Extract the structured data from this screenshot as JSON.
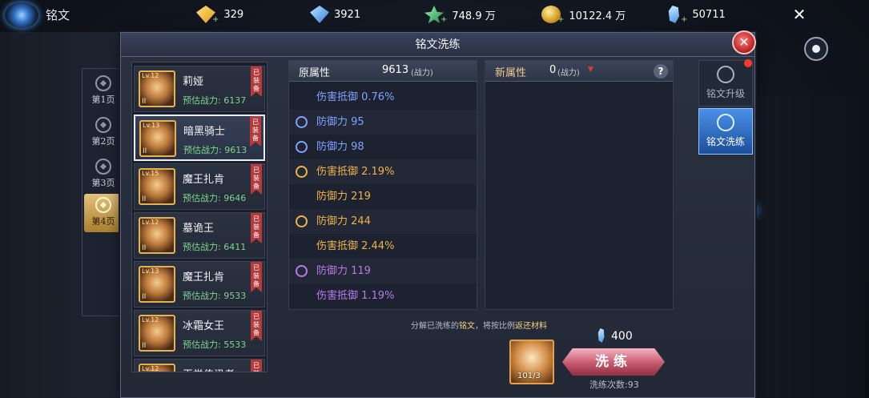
{
  "top_bar": {
    "page_name": "铭文",
    "resources": [
      {
        "icon": "gold-diamond-icon",
        "value": "329"
      },
      {
        "icon": "blue-diamond-icon",
        "value": "3921"
      },
      {
        "icon": "green-gem-icon",
        "value": "748.9 万"
      },
      {
        "icon": "gold-coin-icon",
        "value": "10122.4 万"
      },
      {
        "icon": "blue-crystal-icon",
        "value": "50711"
      }
    ],
    "close_symbol": "✕"
  },
  "panel": {
    "title": "铭文洗练",
    "close_symbol": "✕"
  },
  "page_tabs": [
    {
      "label": "第1页",
      "active": false
    },
    {
      "label": "第2页",
      "active": false
    },
    {
      "label": "第3页",
      "active": false
    },
    {
      "label": "第4页",
      "active": true
    }
  ],
  "heroes": [
    {
      "lv": "Lv.12",
      "rank": "II",
      "name": "莉娅",
      "power": "预估战力: 6137",
      "tag": "已装备",
      "selected": false
    },
    {
      "lv": "Lv.13",
      "rank": "II",
      "name": "暗黑骑士",
      "power": "预估战力: 9613",
      "tag": "已装备",
      "selected": true
    },
    {
      "lv": "Lv.15",
      "rank": "II",
      "name": "魔王扎肯",
      "power": "预估战力: 9646",
      "tag": "已装备",
      "selected": false
    },
    {
      "lv": "Lv.12",
      "rank": "II",
      "name": "墓诡王",
      "power": "预估战力: 6411",
      "tag": "已装备",
      "selected": false
    },
    {
      "lv": "Lv.13",
      "rank": "II",
      "name": "魔王扎肯",
      "power": "预估战力: 9533",
      "tag": "已装备",
      "selected": false
    },
    {
      "lv": "Lv.12",
      "rank": "II",
      "name": "冰霜女王",
      "power": "预估战力: 5533",
      "tag": "已装备",
      "selected": false
    },
    {
      "lv": "Lv.12",
      "rank": "",
      "name": "王党传讯者",
      "power": "",
      "tag": "已装备",
      "selected": false
    }
  ],
  "original": {
    "label": "原属性",
    "value": "9613",
    "unit": "(战力)",
    "attributes": [
      {
        "text": "伤害抵御 0.76%",
        "color": "#7fa2ff",
        "icon": ""
      },
      {
        "text": "防御力 95",
        "color": "#7fa2ff",
        "icon": "blue-ring-icon"
      },
      {
        "text": "防御力 98",
        "color": "#7fa2ff",
        "icon": "blue-ring-icon"
      },
      {
        "text": "伤害抵御 2.19%",
        "color": "#f0b24a",
        "icon": "orange-ring-icon"
      },
      {
        "text": "防御力 219",
        "color": "#f0b24a",
        "icon": ""
      },
      {
        "text": "防御力 244",
        "color": "#f0b24a",
        "icon": "orange-ring-icon"
      },
      {
        "text": "伤害抵御 2.44%",
        "color": "#f0b24a",
        "icon": ""
      },
      {
        "text": "防御力 119",
        "color": "#b87be8",
        "icon": "purple-ring-icon"
      },
      {
        "text": "伤害抵御 1.19%",
        "color": "#b87be8",
        "icon": ""
      }
    ]
  },
  "new_attr": {
    "label": "新属性",
    "value": "0",
    "unit": "(战力)",
    "arrow": "▼",
    "help": "?"
  },
  "bottom": {
    "note_pre": "分解已洗练的",
    "note_hl1": "铭文",
    "note_mid": "，将按比例",
    "note_hl2": "返还材料",
    "material_count": "101/3",
    "cost": "400",
    "refine_label": "洗练",
    "refine_count": "洗练次数:93"
  },
  "right_tabs": [
    {
      "label": "铭文升级",
      "active": false
    },
    {
      "label": "铭文洗练",
      "active": true
    }
  ]
}
